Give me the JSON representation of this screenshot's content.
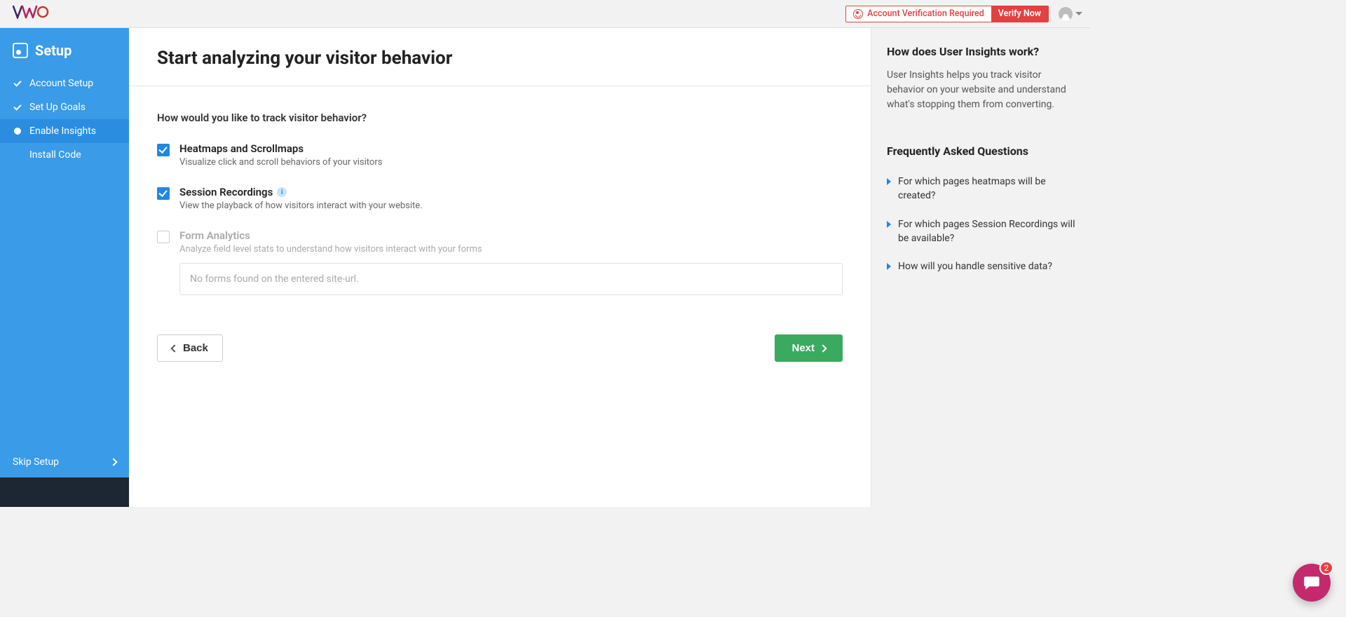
{
  "topbar": {
    "logo_text": "VWO",
    "verify_label": "Account Verification Required",
    "verify_button": "Verify Now"
  },
  "sidebar": {
    "title": "Setup",
    "items": [
      {
        "label": "Account Setup",
        "status": "done"
      },
      {
        "label": "Set Up Goals",
        "status": "done"
      },
      {
        "label": "Enable Insights",
        "status": "active"
      },
      {
        "label": "Install Code",
        "status": ""
      }
    ],
    "skip_label": "Skip Setup"
  },
  "page": {
    "title": "Start analyzing your visitor behavior",
    "question": "How would you like to track visitor behavior?",
    "options": [
      {
        "title": "Heatmaps and Scrollmaps",
        "desc": "Visualize click and scroll behaviors of your visitors",
        "checked": true,
        "info": false
      },
      {
        "title": "Session Recordings",
        "desc": "View the playback of how visitors interact with your website.",
        "checked": true,
        "info": true
      },
      {
        "title": "Form Analytics",
        "desc": "Analyze field level stats to understand how visitors interact with your forms",
        "checked": false,
        "info": false,
        "disabled": true
      }
    ],
    "forms_empty_message": "No forms found on the entered site-url.",
    "back_label": "Back",
    "next_label": "Next"
  },
  "right": {
    "help_title": "How does User Insights work?",
    "help_body": "User Insights helps you track visitor behavior on your website and understand what's stopping them from converting.",
    "faq_title": "Frequently Asked Questions",
    "faqs": [
      "For which pages heatmaps will be created?",
      "For which pages Session Recordings will be available?",
      "How will you handle sensitive data?"
    ]
  },
  "chat": {
    "badge": "2"
  }
}
